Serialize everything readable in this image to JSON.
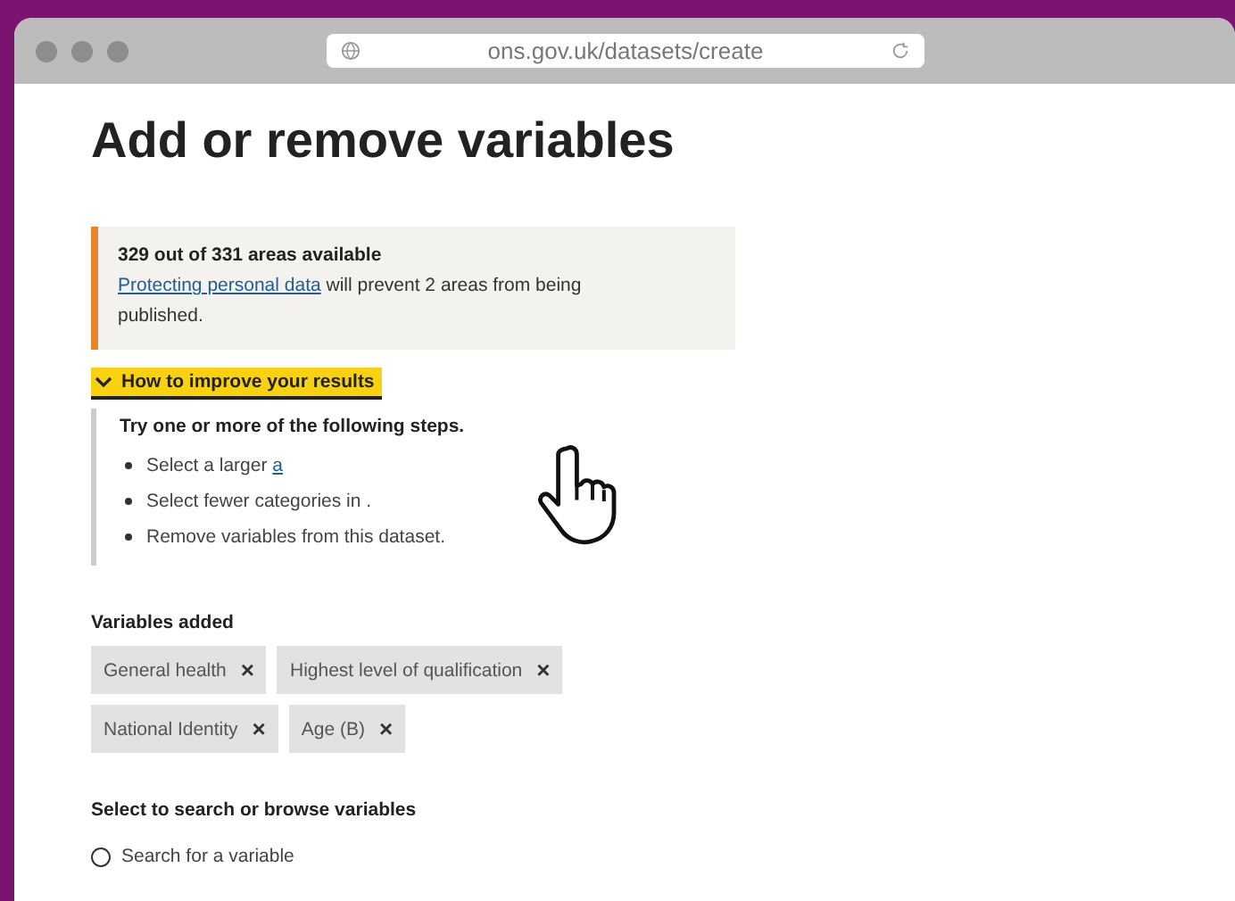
{
  "browser": {
    "url": "ons.gov.uk/datasets/create"
  },
  "page": {
    "title": "Add or remove variables",
    "notice": {
      "heading": "329 out of 331 areas available",
      "link": "Protecting personal data",
      "text": " will prevent 2 areas from being published."
    },
    "details": {
      "summary": "How to improve your results",
      "expanded": true,
      "intro": "Try one or more of the following steps.",
      "steps": [
        {
          "text": "Select a larger ",
          "link": "a"
        },
        {
          "text": "Select fewer categories in ."
        },
        {
          "text": "Remove variables from this dataset."
        }
      ]
    },
    "variables_label": "Variables added",
    "variables": [
      {
        "label": "General health",
        "remove": "×"
      },
      {
        "label": "Highest level of qualification",
        "remove": "×"
      },
      {
        "label": "National Identity",
        "remove": "×"
      },
      {
        "label": "Age (B)",
        "remove": "×"
      }
    ],
    "select_label": "Select to search or browse variables",
    "options": [
      {
        "label": "Search for a variable",
        "selected": false
      }
    ]
  }
}
